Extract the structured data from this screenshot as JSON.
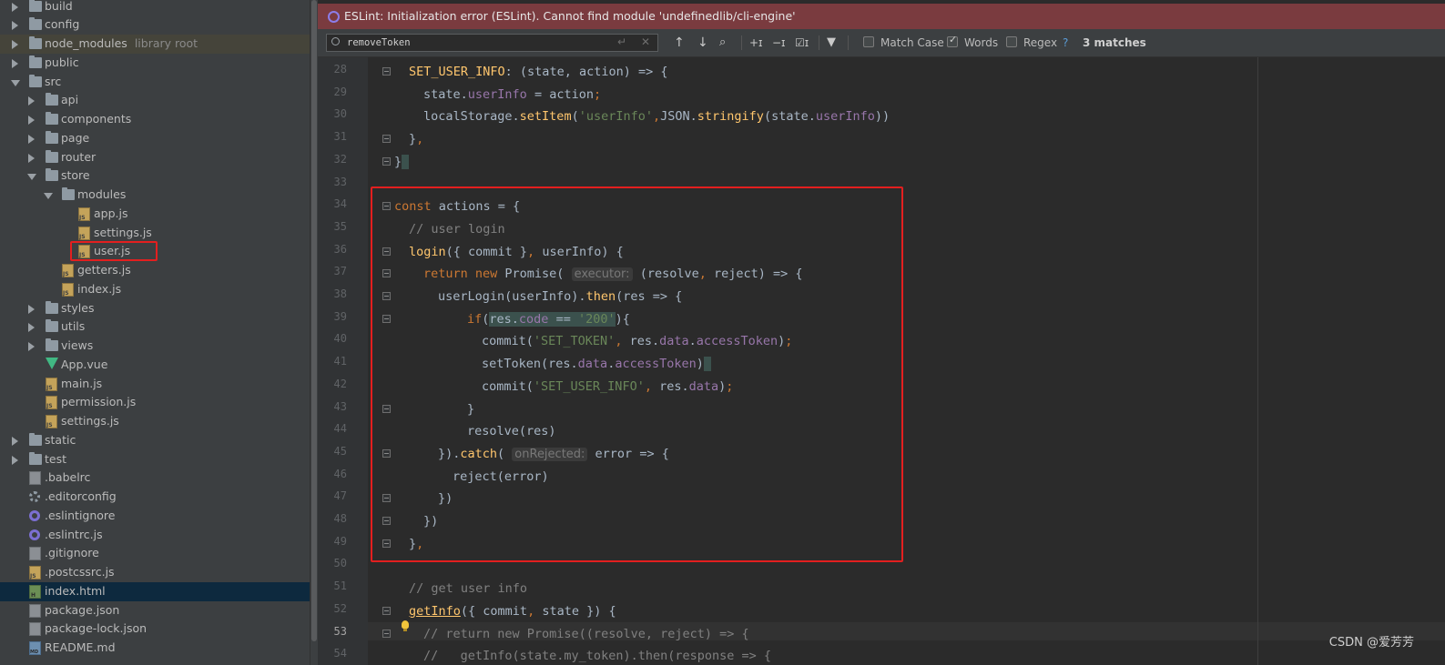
{
  "project_tree": [
    {
      "label": "build",
      "type": "folder",
      "depth": 0,
      "arrow": "right"
    },
    {
      "label": "config",
      "type": "folder",
      "depth": 0,
      "arrow": "right"
    },
    {
      "label": "node_modules",
      "hint": "library root",
      "type": "folder",
      "depth": 0,
      "arrow": "right",
      "library": true
    },
    {
      "label": "public",
      "type": "folder",
      "depth": 0,
      "arrow": "right"
    },
    {
      "label": "src",
      "type": "folder",
      "depth": 0,
      "arrow": "down"
    },
    {
      "label": "api",
      "type": "folder",
      "depth": 1,
      "arrow": "right"
    },
    {
      "label": "components",
      "type": "folder",
      "depth": 1,
      "arrow": "right"
    },
    {
      "label": "page",
      "type": "folder",
      "depth": 1,
      "arrow": "right"
    },
    {
      "label": "router",
      "type": "folder",
      "depth": 1,
      "arrow": "right"
    },
    {
      "label": "store",
      "type": "folder",
      "depth": 1,
      "arrow": "down"
    },
    {
      "label": "modules",
      "type": "folder",
      "depth": 2,
      "arrow": "down"
    },
    {
      "label": "app.js",
      "type": "js",
      "depth": 3
    },
    {
      "label": "settings.js",
      "type": "js",
      "depth": 3
    },
    {
      "label": "user.js",
      "type": "js",
      "depth": 3
    },
    {
      "label": "getters.js",
      "type": "js",
      "depth": 2
    },
    {
      "label": "index.js",
      "type": "js",
      "depth": 2
    },
    {
      "label": "styles",
      "type": "folder",
      "depth": 1,
      "arrow": "right"
    },
    {
      "label": "utils",
      "type": "folder",
      "depth": 1,
      "arrow": "right"
    },
    {
      "label": "views",
      "type": "folder",
      "depth": 1,
      "arrow": "right"
    },
    {
      "label": "App.vue",
      "type": "vue",
      "depth": 1
    },
    {
      "label": "main.js",
      "type": "js",
      "depth": 1
    },
    {
      "label": "permission.js",
      "type": "js",
      "depth": 1
    },
    {
      "label": "settings.js",
      "type": "js",
      "depth": 1
    },
    {
      "label": "static",
      "type": "folder",
      "depth": 0,
      "arrow": "right"
    },
    {
      "label": "test",
      "type": "folder",
      "depth": 0,
      "arrow": "right"
    },
    {
      "label": ".babelrc",
      "type": "json",
      "depth": 0
    },
    {
      "label": ".editorconfig",
      "type": "gear",
      "depth": 0
    },
    {
      "label": ".eslintignore",
      "type": "eslint",
      "depth": 0
    },
    {
      "label": ".eslintrc.js",
      "type": "eslint",
      "depth": 0
    },
    {
      "label": ".gitignore",
      "type": "json",
      "depth": 0
    },
    {
      "label": ".postcssrc.js",
      "type": "js",
      "depth": 0
    },
    {
      "label": "index.html",
      "type": "html",
      "depth": 0,
      "selected": true
    },
    {
      "label": "package.json",
      "type": "json",
      "depth": 0
    },
    {
      "label": "package-lock.json",
      "type": "json",
      "depth": 0
    },
    {
      "label": "README.md",
      "type": "md",
      "depth": 0
    }
  ],
  "eslint_banner": "ESLint: Initialization error (ESLint). Cannot find module 'undefinedlib/cli-engine'",
  "find": {
    "query": "removeToken",
    "enter_glyph": "↵",
    "clear_glyph": "✕",
    "match_case_label": "Match Case",
    "match_case_checked": false,
    "words_label": "Words",
    "words_checked": true,
    "regex_label": "Regex",
    "regex_checked": false,
    "help": "?",
    "matches": "3 matches"
  },
  "code": {
    "current_line": 53,
    "lines": [
      {
        "n": 28,
        "indent": 1,
        "html": "<span class=\"f\">SET_USER_INFO</span>: (state, action) => {",
        "fold": true
      },
      {
        "n": 29,
        "indent": 2,
        "html": "state.<span class=\"p\">userInfo</span> = action<span class=\"k\">;</span>"
      },
      {
        "n": 30,
        "indent": 2,
        "html": "localStorage.<span class=\"f\">setItem</span>(<span class=\"s\">'userInfo'</span><span class=\"k\">,</span>JSON.<span class=\"f\">stringify</span>(state.<span class=\"p\">userInfo</span>))"
      },
      {
        "n": 31,
        "indent": 1,
        "html": "}<span class=\"k\">,</span>",
        "fold": true
      },
      {
        "n": 32,
        "indent": 0,
        "html": "}<span class=\"brace-hl\"> </span>",
        "fold": true
      },
      {
        "n": 33,
        "indent": 0,
        "html": ""
      },
      {
        "n": 34,
        "indent": 0,
        "html": "<span class=\"k\">const</span> actions = {",
        "fold": true
      },
      {
        "n": 35,
        "indent": 1,
        "html": "<span class=\"c\">// user login</span>"
      },
      {
        "n": 36,
        "indent": 1,
        "html": "<span class=\"f\">login</span>({ commit }<span class=\"k\">,</span> userInfo) {",
        "fold": true
      },
      {
        "n": 37,
        "indent": 2,
        "html": "<span class=\"k\">return new</span> Promise( <span class=\"hint-inlay\">executor:</span> (resolve<span class=\"k\">,</span> reject) => {",
        "fold": true
      },
      {
        "n": 38,
        "indent": 3,
        "html": "userLogin(userInfo).<span class=\"f\">then</span>(res => {",
        "fold": true
      },
      {
        "n": 39,
        "indent": 5,
        "html": "<span class=\"k\">if</span>(<span class=\"match-hl\">res.<span class=\"p\">code</span> == <span class=\"s\">'200'</span></span>){",
        "fold": true
      },
      {
        "n": 40,
        "indent": 6,
        "html": "commit(<span class=\"s\">'SET_TOKEN'</span><span class=\"k\">,</span> res.<span class=\"p\">data</span>.<span class=\"p\">accessToken</span>)<span class=\"k\">;</span>"
      },
      {
        "n": 41,
        "indent": 6,
        "html": "setToken(res.<span class=\"p\">data</span>.<span class=\"p\">accessToken</span>)<span class=\"brace-hl\"> </span>"
      },
      {
        "n": 42,
        "indent": 6,
        "html": "commit(<span class=\"s\">'SET_USER_INFO'</span><span class=\"k\">,</span> res.<span class=\"p\">data</span>)<span class=\"k\">;</span>"
      },
      {
        "n": 43,
        "indent": 5,
        "html": "}",
        "fold": true
      },
      {
        "n": 44,
        "indent": 5,
        "html": "resolve(res)"
      },
      {
        "n": 45,
        "indent": 3,
        "html": "}).<span class=\"f\">catch</span>( <span class=\"hint-inlay\">onRejected:</span> error => {",
        "fold": true
      },
      {
        "n": 46,
        "indent": 4,
        "html": "reject(error)"
      },
      {
        "n": 47,
        "indent": 3,
        "html": "})",
        "fold": true
      },
      {
        "n": 48,
        "indent": 2,
        "html": "})",
        "fold": true
      },
      {
        "n": 49,
        "indent": 1,
        "html": "}<span class=\"k\">,</span>",
        "fold": true
      },
      {
        "n": 50,
        "indent": 0,
        "html": ""
      },
      {
        "n": 51,
        "indent": 1,
        "html": "<span class=\"c\">// get user info</span>"
      },
      {
        "n": 52,
        "indent": 1,
        "html": "<span class=\"f\" style=\"text-decoration:underline\">getInfo</span>({ commit<span class=\"k\">,</span> state }) {",
        "fold": true
      },
      {
        "n": 53,
        "indent": 2,
        "html": "<span class=\"c\">// return new Promise((resolve, reject) => {</span>",
        "fold": true
      },
      {
        "n": 54,
        "indent": 2,
        "html": "<span class=\"c\">//   getInfo(state.my_token).then(response => {</span>"
      }
    ]
  },
  "watermark": "CSDN @爱芳芳",
  "colors": {
    "highlight_box": "#e31f1f",
    "banner_bg": "#7a3b3f",
    "selection": "#0d293e"
  }
}
